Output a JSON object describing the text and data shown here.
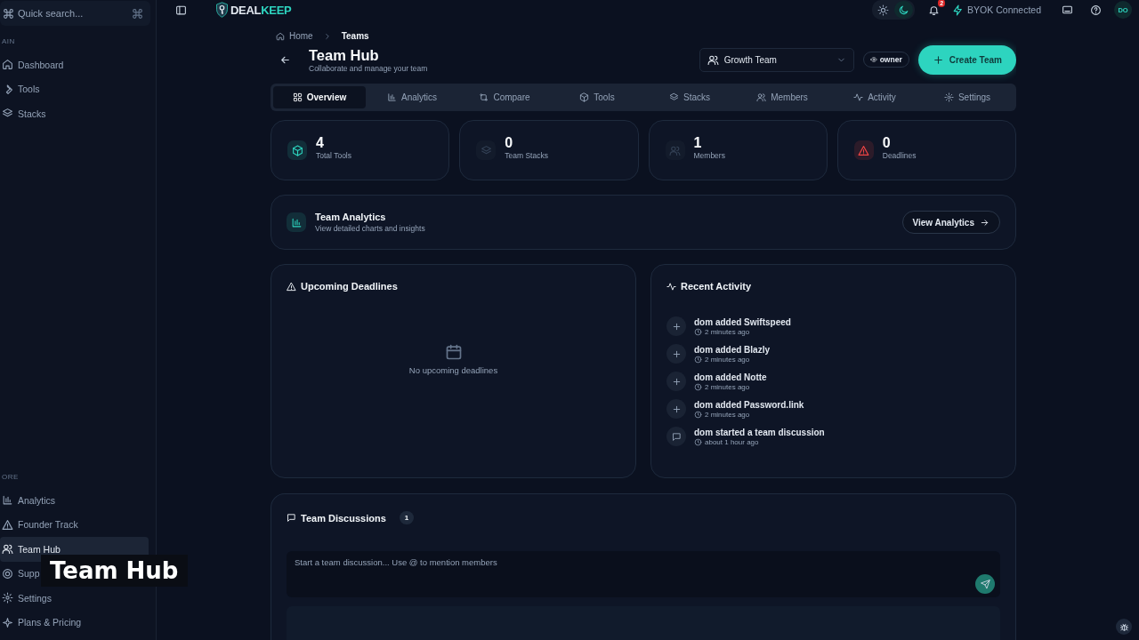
{
  "sidebar": {
    "search": {
      "placeholder": "Quick search..."
    },
    "sections": [
      {
        "label": "AIN",
        "items": [
          {
            "label": "Dashboard",
            "selected": false
          },
          {
            "label": "Tools",
            "selected": false
          },
          {
            "label": "Stacks",
            "selected": false
          }
        ]
      },
      {
        "label": "ORE",
        "items": [
          {
            "label": "Analytics",
            "selected": false
          },
          {
            "label": "Founder Track",
            "selected": false
          },
          {
            "label": "Team Hub",
            "selected": true
          },
          {
            "label": "Supp",
            "selected": false
          },
          {
            "label": "Settings",
            "selected": false
          },
          {
            "label": "Plans & Pricing",
            "selected": false
          }
        ]
      }
    ]
  },
  "topbar": {
    "logo": {
      "part1": "DEAL",
      "part2": "KEEP"
    },
    "dark_mode": true,
    "notifications": "2",
    "byok": "BYOK Connected",
    "avatar": "DO"
  },
  "breadcrumb": [
    "Home",
    "Teams"
  ],
  "header": {
    "title": "Team Hub",
    "subtitle": "Collaborate and manage your team",
    "team": "Growth Team",
    "role": "owner",
    "create": "Create Team"
  },
  "tabs": [
    {
      "label": "Overview",
      "selected": true
    },
    {
      "label": "Analytics",
      "selected": false
    },
    {
      "label": "Compare",
      "selected": false
    },
    {
      "label": "Tools",
      "selected": false
    },
    {
      "label": "Stacks",
      "selected": false
    },
    {
      "label": "Members",
      "selected": false
    },
    {
      "label": "Activity",
      "selected": false
    },
    {
      "label": "Settings",
      "selected": false
    }
  ],
  "stats": [
    {
      "value": "4",
      "label": "Total Tools",
      "color": "#2dd4bf"
    },
    {
      "value": "0",
      "label": "Team Stacks",
      "color": "#334155"
    },
    {
      "value": "1",
      "label": "Members",
      "color": "#334155"
    },
    {
      "value": "0",
      "label": "Deadlines",
      "color": "#ef4444"
    }
  ],
  "analytics_card": {
    "title": "Team Analytics",
    "subtitle": "View detailed charts and insights",
    "button": "View Analytics"
  },
  "deadlines": {
    "title": "Upcoming Deadlines",
    "empty": "No upcoming deadlines"
  },
  "activity": {
    "title": "Recent Activity",
    "items": [
      {
        "kind": "add",
        "text": "dom added Swiftspeed",
        "time": "2 minutes ago"
      },
      {
        "kind": "add",
        "text": "dom added Blazly",
        "time": "2 minutes ago"
      },
      {
        "kind": "add",
        "text": "dom added Notte",
        "time": "2 minutes ago"
      },
      {
        "kind": "add",
        "text": "dom added Password.link",
        "time": "2 minutes ago"
      },
      {
        "kind": "discussion",
        "text": "dom started a team discussion",
        "time": "about 1 hour ago"
      }
    ]
  },
  "discussions": {
    "title": "Team Discussions",
    "count": "1",
    "placeholder": "Start a team discussion... Use @ to mention members"
  },
  "caption": "Team Hub"
}
